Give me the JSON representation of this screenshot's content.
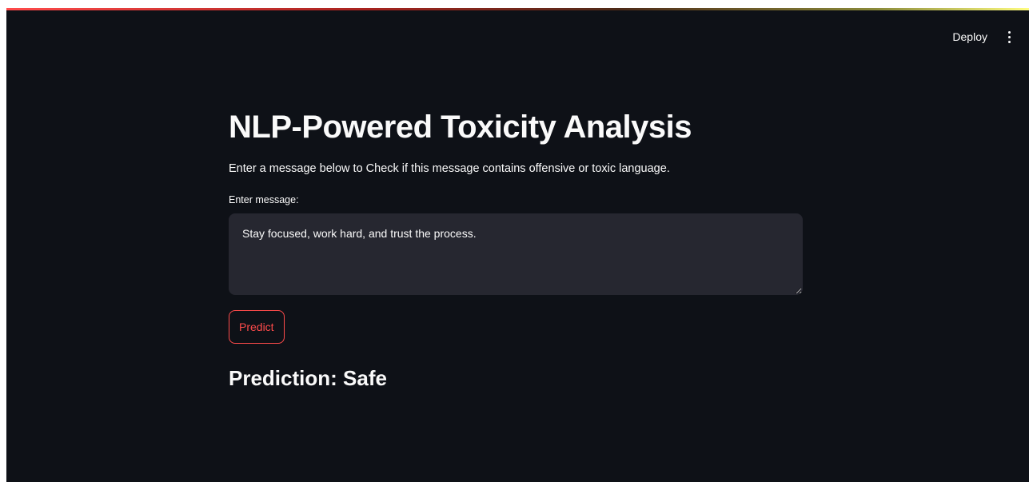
{
  "header": {
    "deploy_label": "Deploy",
    "menu_icon": "kebab-menu-icon"
  },
  "main": {
    "title": "NLP-Powered Toxicity Analysis",
    "description": "Enter a message below to Check if this message contains offensive or toxic language.",
    "input_label": "Enter message:",
    "input_value": "Stay focused, work hard, and trust the process.",
    "predict_label": "Predict",
    "result_text": "Prediction: Safe"
  },
  "colors": {
    "background": "#0e1117",
    "accent": "#ff4b4b",
    "input_bg": "#262730",
    "text": "#fafafa"
  }
}
